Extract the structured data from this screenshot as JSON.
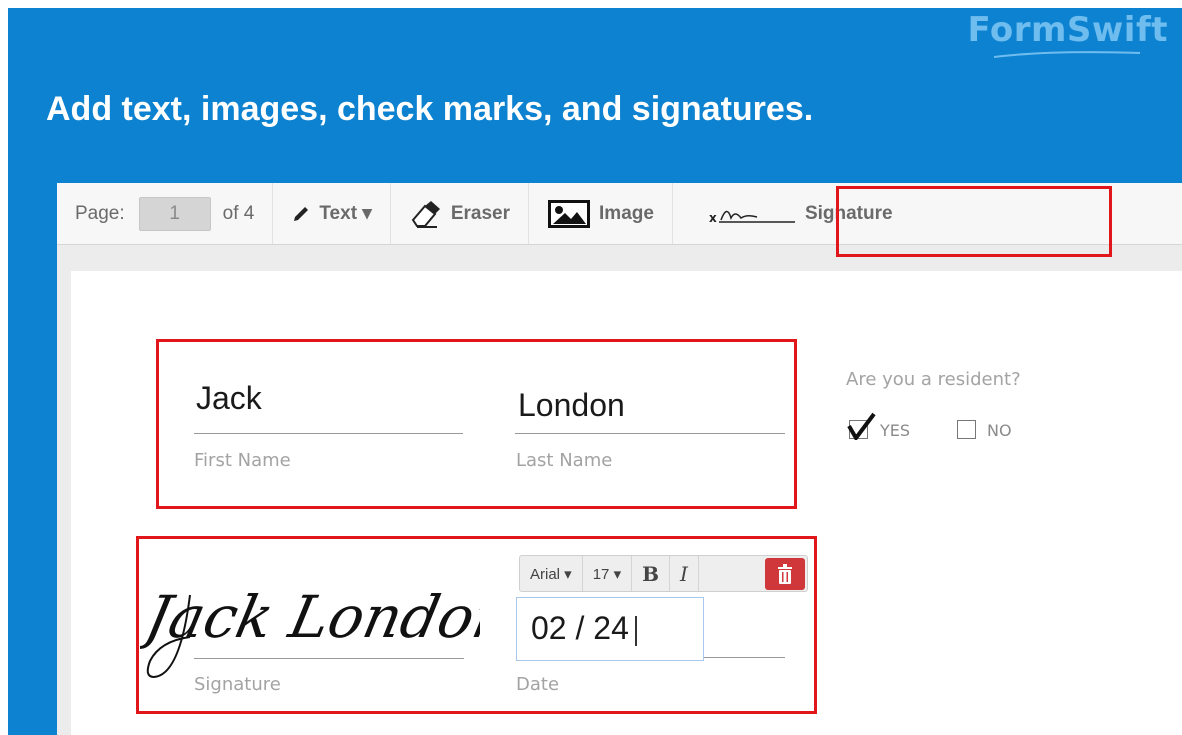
{
  "brand": {
    "name": "FormSwift"
  },
  "headline": "Add text, images, check marks, and signatures.",
  "toolbar": {
    "page_label": "Page:",
    "page_value": "1",
    "of_label": "of 4",
    "text_tool": "Text ▾",
    "eraser_tool": "Eraser",
    "image_tool": "Image",
    "signature_tool": "Signature"
  },
  "form": {
    "first_name": {
      "value": "Jack",
      "label": "First Name"
    },
    "last_name": {
      "value": "London",
      "label": "Last Name"
    },
    "resident": {
      "question": "Are you a resident?",
      "yes_label": "YES",
      "no_label": "NO",
      "yes_checked": true
    },
    "signature": {
      "value": "Jack London",
      "label": "Signature"
    },
    "date": {
      "value": "02 / 24",
      "label": "Date"
    }
  },
  "format_bar": {
    "font": "Arial ▾",
    "size": "17 ▾",
    "bold": "B",
    "italic": "I"
  },
  "colors": {
    "banner": "#0c82d0",
    "highlight": "#e0161b",
    "delete_button": "#d0373a"
  }
}
